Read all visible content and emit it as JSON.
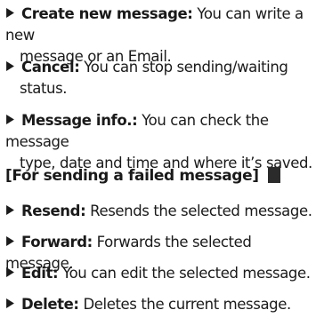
{
  "items": [
    {
      "term": "Create new message:",
      "desc_first": "You can write a new",
      "desc_rest": "message or an Email."
    },
    {
      "term": "Cancel:",
      "desc_first": "You can stop sending/waiting",
      "desc_rest": "status."
    },
    {
      "term": "Message info.:",
      "desc_first": "You can check the message",
      "desc_rest": "type, date and time and where it’s saved."
    }
  ],
  "section": {
    "heading": "[For sending a failed message]"
  },
  "failed_items": [
    {
      "term": "Resend:",
      "desc": "Resends the selected message."
    },
    {
      "term": "Forward:",
      "desc": "Forwards the selected message."
    },
    {
      "term": "Edit:",
      "desc": "You can edit the selected message."
    },
    {
      "term": "Delete:",
      "desc": "Deletes the current message."
    }
  ],
  "colors": {
    "text": "#1a1a1a",
    "marker": "#2b2b2b"
  },
  "icons": {
    "bullet": "triangle-bullet-icon",
    "marker": "square-marker-icon"
  }
}
